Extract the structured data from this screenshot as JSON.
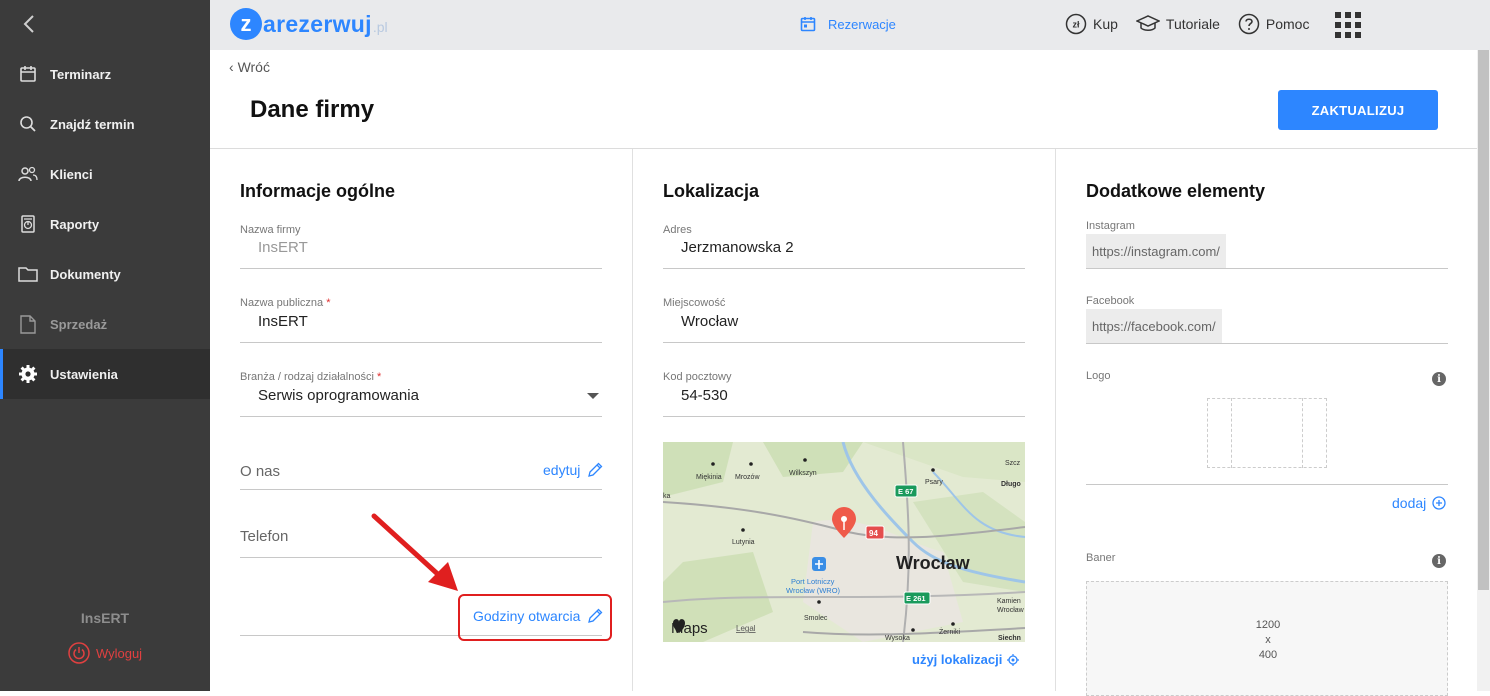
{
  "sidebar": {
    "items": [
      {
        "label": "Terminarz"
      },
      {
        "label": "Znajdź termin"
      },
      {
        "label": "Klienci"
      },
      {
        "label": "Raporty"
      },
      {
        "label": "Dokumenty"
      },
      {
        "label": "Sprzedaż"
      },
      {
        "label": "Ustawienia"
      }
    ],
    "active_item": "Ustawienia",
    "company": "InsERT",
    "logout": "Wyloguj"
  },
  "topbar": {
    "logo_main": "zarezerwuj",
    "logo_letter": "z",
    "logo_rest": "arezerwuj",
    "logo_tld": ".pl",
    "center_link": "Rezerwacje",
    "buy": "Kup",
    "buy_icon_text": "zł",
    "tutorials": "Tutoriale",
    "help": "Pomoc"
  },
  "page": {
    "back": "Wróć",
    "title": "Dane firmy",
    "update_button": "ZAKTUALIZUJ"
  },
  "general": {
    "title": "Informacje ogólne",
    "company_name_label": "Nazwa firmy",
    "company_name_value": "InsERT",
    "public_name_label": "Nazwa publiczna",
    "public_name_value": "InsERT",
    "industry_label": "Branża / rodzaj działalności",
    "industry_value": "Serwis oprogramowania",
    "required_mark": "*",
    "about_label": "O nas",
    "about_edit": "edytuj",
    "phone_label": "Telefon",
    "hours_link": "Godziny otwarcia"
  },
  "location": {
    "title": "Lokalizacja",
    "address_label": "Adres",
    "address_value": "Jerzmanowska 2",
    "city_label": "Miejscowość",
    "city_value": "Wrocław",
    "postal_label": "Kod pocztowy",
    "postal_value": "54-530",
    "use_location": "użyj lokalizacji",
    "map": {
      "city": "Wrocław",
      "airport": "Port Lotniczy Wrocław (WRO)",
      "places": [
        "Miękinia",
        "Mrozów",
        "Wilkszyn",
        "Psary",
        "Lutynia",
        "Smolec",
        "Żerniki",
        "Wysoka",
        "Długo",
        "Szcz",
        "Siechn",
        "Kamien",
        "Wrocław",
        "ka"
      ],
      "roads": [
        "E 67",
        "94",
        "E 261"
      ],
      "brand": "Maps",
      "legal": "Legal"
    }
  },
  "extras": {
    "title": "Dodatkowe elementy",
    "instagram_label": "Instagram",
    "instagram_prefix": "https://instagram.com/",
    "facebook_label": "Facebook",
    "facebook_prefix": "https://facebook.com/",
    "logo_label": "Logo",
    "add_link": "dodaj",
    "banner_label": "Baner",
    "banner_w": "1200",
    "banner_x": "x",
    "banner_h": "400"
  },
  "colors": {
    "accent": "#2d86ff",
    "sidebar_bg": "#3b3b3b",
    "danger": "#e01f1f"
  }
}
